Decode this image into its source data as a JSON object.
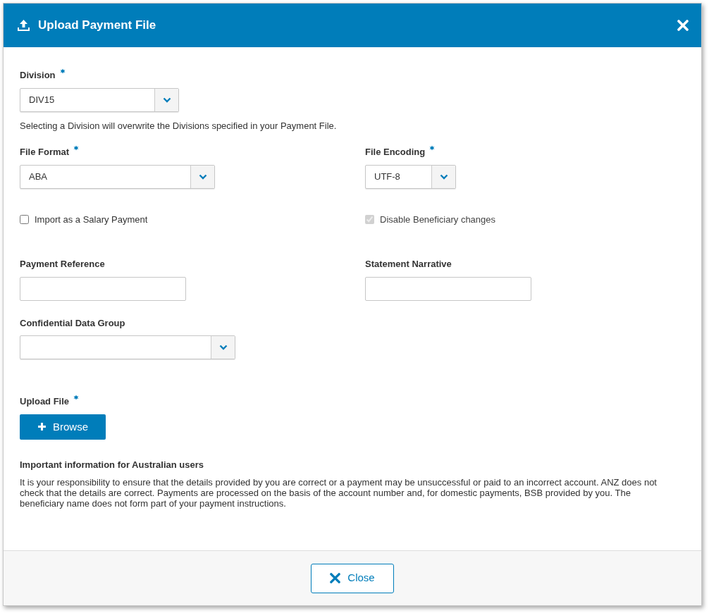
{
  "dialog": {
    "title": "Upload Payment File"
  },
  "rows": [
    [
      {
        "kind": "select",
        "label": "Division",
        "required": true,
        "value": "DIV15",
        "help": "Selecting a Division will overwrite the Divisions specified in your Payment File."
      }
    ],
    [
      {
        "kind": "select",
        "label": "File Format",
        "required": true,
        "value": "ABA"
      },
      {
        "kind": "select",
        "label": "File Encoding",
        "required": true,
        "value": "UTF-8"
      }
    ],
    [
      {
        "kind": "checkbox",
        "label": "Import as a Salary Payment",
        "checked": false,
        "disabled": false
      },
      {
        "kind": "checkbox",
        "label": "Disable Beneficiary changes",
        "checked": true,
        "disabled": true
      }
    ],
    [
      {
        "kind": "text",
        "label": "Payment Reference",
        "required": false
      },
      {
        "kind": "text",
        "label": "Statement Narrative",
        "required": false
      }
    ],
    [
      {
        "kind": "select",
        "label": "Confidential Data Group",
        "required": false
      }
    ],
    [
      {
        "kind": "upload",
        "label": "Upload File",
        "required": true,
        "button": "Browse"
      }
    ]
  ],
  "notice": {
    "title": "Important information for Australian users",
    "body": "It is your responsibility to ensure that the details provided by you are correct or a payment may be unsuccessful or paid to an incorrect account. ANZ does not check that the details are correct. Payments are processed on the basis of the account number and, for domestic payments, BSB provided by you. The beneficiary name does not form part of your payment instructions."
  },
  "footer": {
    "close_button": "Close"
  }
}
